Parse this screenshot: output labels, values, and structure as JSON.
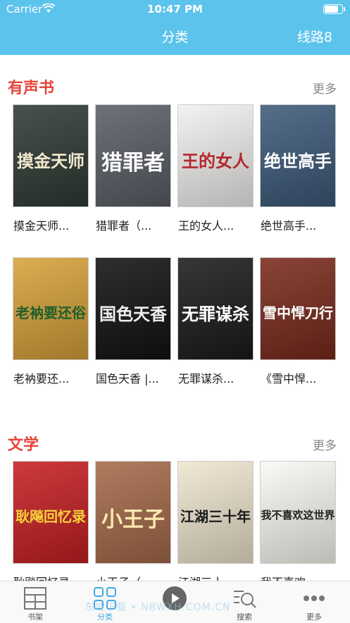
{
  "status_bar": {
    "carrier": "Carrier",
    "time": "10:47 PM",
    "battery_level": 0.85
  },
  "navbar": {
    "title": "分类",
    "route_label": "线路8"
  },
  "sections": [
    {
      "title": "有声书",
      "more_label": "更多",
      "books": [
        {
          "title": "摸金天师...",
          "cover_text": "摸金天师",
          "bg": "#2f3a34",
          "fg": "#f1e9cf"
        },
        {
          "title": "猎罪者（...",
          "cover_text": "猎罪者",
          "bg": "#5a5f66",
          "fg": "#ffffff"
        },
        {
          "title": "王的女人...",
          "cover_text": "王的女人",
          "bg": "#f3f1ef",
          "fg": "#b3282d"
        },
        {
          "title": "绝世高手...",
          "cover_text": "绝世高手",
          "bg": "#3d5a7a",
          "fg": "#ffffff"
        },
        {
          "title": "老衲要还...",
          "cover_text": "老衲要还俗",
          "bg": "#d7a23a",
          "fg": "#1f5f2a"
        },
        {
          "title": "国色天香 |...",
          "cover_text": "国色天香",
          "bg": "#121212",
          "fg": "#f0f0f0"
        },
        {
          "title": "无罪谋杀...",
          "cover_text": "无罪谋杀",
          "bg": "#1b1b1b",
          "fg": "#ffffff"
        },
        {
          "title": "《雪中悍...",
          "cover_text": "雪中悍刀行",
          "bg": "#7a2a1c",
          "fg": "#ffffff"
        }
      ]
    },
    {
      "title": "文学",
      "more_label": "更多",
      "books": [
        {
          "title": "耿飚回忆录...",
          "cover_text": "耿飚回忆录",
          "bg": "#c61f22",
          "fg": "#f5d23a"
        },
        {
          "title": "小王子（...",
          "cover_text": "小王子",
          "bg": "#a56a4a",
          "fg": "#ffe9b0"
        },
        {
          "title": "江湖三十...",
          "cover_text": "江湖三十年",
          "bg": "#efe6cf",
          "fg": "#1a1a1a"
        },
        {
          "title": "我不喜欢...",
          "cover_text": "我不喜欢这世界",
          "bg": "#fbf9f2",
          "fg": "#222222"
        }
      ]
    }
  ],
  "tab_bar": [
    {
      "label": "书架",
      "icon": "bookshelf-icon",
      "active": false
    },
    {
      "label": "分类",
      "icon": "category-grid-icon",
      "active": true
    },
    {
      "label": "",
      "icon": "play-icon",
      "active": false
    },
    {
      "label": "搜索",
      "icon": "search-icon",
      "active": false
    },
    {
      "label": "更多",
      "icon": "more-icon",
      "active": false
    }
  ],
  "watermark": "东坡下载 • NBWXH.COM.CN",
  "colors": {
    "accent": "#5bc3ec",
    "section_title": "#e8443a",
    "tab_active": "#3fa9e0"
  }
}
